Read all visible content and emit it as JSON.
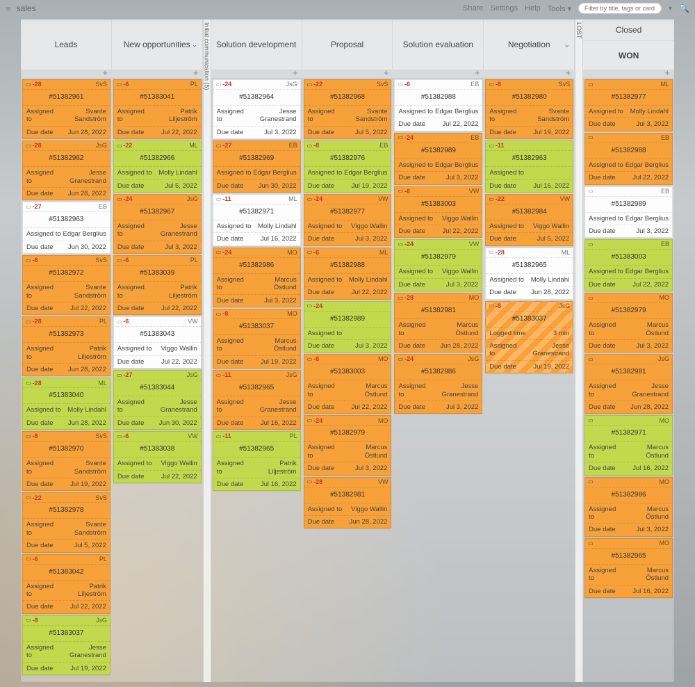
{
  "top": {
    "app": "sales",
    "links": {
      "share": "Share",
      "settings": "Settings",
      "help": "Help",
      "tools": "Tools ▾"
    },
    "filter_placeholder": "Filter by title, tags or card name"
  },
  "labels": {
    "assigned": "Assigned to",
    "due": "Due date",
    "logged": "Logged time"
  },
  "swimlanes": {
    "initial": "Initial communication (5)",
    "lost": "LOST"
  },
  "columns": [
    {
      "title": "Leads"
    },
    {
      "title": "New opportunities",
      "chevron": true
    },
    {
      "title": "Solution development"
    },
    {
      "title": "Proposal"
    },
    {
      "title": "Solution evaluation"
    },
    {
      "title": "Negotiation",
      "chevron": true
    },
    {
      "closed": "Closed",
      "won": "WON"
    }
  ],
  "board": [
    [
      {
        "c": "orange",
        "d": "-28",
        "in": "SvS",
        "id": "#51382961",
        "a": "Svante Sandström",
        "due": "Jun 28, 2022"
      },
      {
        "c": "orange",
        "d": "-28",
        "in": "JsG",
        "id": "#51382962",
        "a": "Jesse Granestrand",
        "due": "Jun 28, 2022"
      },
      {
        "c": "white",
        "d": "-27",
        "in": "EB",
        "id": "#51382963",
        "a": "Edgar Berglius",
        "due": "Jun 30, 2022"
      },
      {
        "c": "orange",
        "d": "-6",
        "in": "SvS",
        "id": "#51382972",
        "a": "Svante Sandström",
        "due": "Jul 22, 2022"
      },
      {
        "c": "orange",
        "d": "-28",
        "in": "PL",
        "id": "#51382973",
        "a": "Patrik Liljeström",
        "due": "Jun 28, 2022"
      },
      {
        "c": "yellow",
        "d": "-28",
        "in": "ML",
        "id": "#51383040",
        "a": "Molly Lindahl",
        "due": "Jun 28, 2022"
      },
      {
        "c": "orange",
        "d": "-8",
        "in": "SvS",
        "id": "#51382970",
        "a": "Svante Sandström",
        "due": "Jul 19, 2022"
      },
      {
        "c": "orange",
        "d": "-22",
        "in": "SvS",
        "id": "#51382978",
        "a": "Svante Sandström",
        "due": "Jul 5, 2022"
      },
      {
        "c": "orange",
        "d": "-6",
        "in": "PL",
        "id": "#51383042",
        "a": "Patrik Liljeström",
        "due": "Jul 22, 2022"
      },
      {
        "c": "yellow",
        "d": "-8",
        "in": "JsG",
        "id": "#51383037",
        "a": "Jesse Granestrand",
        "due": "Jul 19, 2022"
      }
    ],
    [
      {
        "c": "orange",
        "d": "-6",
        "in": "PL",
        "id": "#51383041",
        "a": "Patrik Liljeström",
        "due": "Jul 22, 2022"
      },
      {
        "c": "yellow",
        "d": "-22",
        "in": "ML",
        "id": "#51382966",
        "a": "Molly Lindahl",
        "due": "Jul 5, 2022"
      },
      {
        "c": "orange",
        "d": "-24",
        "in": "JsG",
        "id": "#51382967",
        "a": "Jesse Granestrand",
        "due": "Jul 3, 2022"
      },
      {
        "c": "orange",
        "d": "-6",
        "in": "PL",
        "id": "#51383039",
        "a": "Patrik Liljeström",
        "due": "Jul 22, 2022"
      },
      {
        "c": "white",
        "d": "-6",
        "in": "VW",
        "id": "#51383043",
        "a": "Viggo Wallin",
        "due": "Jul 22, 2022"
      },
      {
        "c": "yellow",
        "d": "-27",
        "in": "JsG",
        "id": "#51383044",
        "a": "Jesse Granestrand",
        "due": "Jun 30, 2022"
      },
      {
        "c": "yellow",
        "d": "-6",
        "in": "VW",
        "id": "#51383038",
        "a": "Viggo Wallin",
        "due": "Jul 22, 2022"
      }
    ],
    [
      {
        "c": "white",
        "d": "-24",
        "in": "JsG",
        "id": "#51382964",
        "a": "Jesse Granestrand",
        "due": "Jul 3, 2022"
      },
      {
        "c": "orange",
        "d": "-27",
        "in": "EB",
        "id": "#51382969",
        "a": "Edgar Berglius",
        "due": "Jun 30, 2022"
      },
      {
        "c": "white",
        "d": "-11",
        "in": "ML",
        "id": "#51382971",
        "a": "Molly Lindahl",
        "due": "Jul 16, 2022"
      },
      {
        "c": "orange",
        "d": "-24",
        "in": "MO",
        "id": "#51382986",
        "a": "Marcus Östlund",
        "due": "Jul 3, 2022"
      },
      {
        "c": "orange",
        "d": "-8",
        "in": "MO",
        "id": "#51383037",
        "a": "Marcus Östlund",
        "due": "Jul 19, 2022"
      },
      {
        "c": "orange",
        "d": "-11",
        "in": "JsG",
        "id": "#51382965",
        "a": "Jesse Granestrand",
        "due": "Jul 16, 2022"
      },
      {
        "c": "yellow",
        "d": "-11",
        "in": "PL",
        "id": "#51382965",
        "a": "Patrik Liljeström",
        "due": "Jul 16, 2022"
      }
    ],
    [
      {
        "c": "orange",
        "d": "-22",
        "in": "SvS",
        "id": "#51382968",
        "a": "Svante Sandström",
        "due": "Jul 5, 2022"
      },
      {
        "c": "yellow",
        "d": "-8",
        "in": "EB",
        "id": "#51382976",
        "a": "Edgar Berglius",
        "due": "Jul 19, 2022"
      },
      {
        "c": "orange",
        "d": "-24",
        "in": "VW",
        "id": "#51382977",
        "a": "Viggo Wallin",
        "due": "Jul 3, 2022"
      },
      {
        "c": "orange",
        "d": "-6",
        "in": "ML",
        "id": "#51382988",
        "a": "Molly Lindahl",
        "due": "Jul 22, 2022"
      },
      {
        "c": "yellow",
        "d": "-24",
        "in": "",
        "id": "#51382989",
        "a": "",
        "due": "Jul 3, 2022"
      },
      {
        "c": "orange",
        "d": "-6",
        "in": "MO",
        "id": "#51383003",
        "a": "Marcus Östlund",
        "due": "Jul 22, 2022"
      },
      {
        "c": "orange",
        "d": "-24",
        "in": "MO",
        "id": "#51382979",
        "a": "Marcus Östlund",
        "due": "Jul 3, 2022"
      },
      {
        "c": "orange",
        "d": "-28",
        "in": "VW",
        "id": "#51382981",
        "a": "Viggo Wallin",
        "due": "Jun 28, 2022"
      }
    ],
    [
      {
        "c": "white",
        "d": "-6",
        "in": "EB",
        "id": "#51382988",
        "a": "Edgar Berglius",
        "due": "Jul 22, 2022"
      },
      {
        "c": "orange",
        "d": "-24",
        "in": "EB",
        "id": "#51382989",
        "a": "Edgar Berglius",
        "due": "Jul 3, 2022"
      },
      {
        "c": "orange",
        "d": "-6",
        "in": "VW",
        "id": "#51383003",
        "a": "Viggo Wallin",
        "due": "Jul 22, 2022"
      },
      {
        "c": "yellow",
        "d": "-24",
        "in": "VW",
        "id": "#51382979",
        "a": "Viggo Wallin",
        "due": "Jul 3, 2022"
      },
      {
        "c": "orange",
        "d": "-28",
        "in": "MO",
        "id": "#51382981",
        "a": "Marcus Östlund",
        "due": "Jun 28, 2022"
      },
      {
        "c": "orange",
        "d": "-24",
        "in": "JsG",
        "id": "#51382986",
        "a": "Jesse Granestrand",
        "due": "Jul 3, 2022"
      }
    ],
    [
      {
        "c": "orange",
        "d": "-8",
        "in": "SvS",
        "id": "#51382980",
        "a": "Svante Sandström",
        "due": "Jul 19, 2022"
      },
      {
        "c": "yellow",
        "d": "-11",
        "in": "",
        "id": "#51382963",
        "a": "",
        "due": "Jul 16, 2022"
      },
      {
        "c": "orange",
        "d": "-22",
        "in": "VW",
        "id": "#51382984",
        "a": "Viggo Wallin",
        "due": "Jul 5, 2022"
      },
      {
        "c": "white",
        "d": "-28",
        "in": "ML",
        "id": "#51382965",
        "a": "Molly Lindahl",
        "due": "Jun 28, 2022"
      },
      {
        "c": "stripe",
        "d": "-8",
        "in": "JsG",
        "id": "#51383037",
        "a": "Jesse Granestrand",
        "due": "Jul 19, 2022",
        "logged": "3 min"
      }
    ],
    [
      {
        "c": "orange",
        "d": "",
        "in": "ML",
        "id": "#51382977",
        "a": "Molly Lindahl",
        "due": "Jul 3, 2022"
      },
      {
        "c": "orange",
        "d": "",
        "in": "EB",
        "id": "#51382988",
        "a": "Edgar Berglius",
        "due": "Jul 22, 2022"
      },
      {
        "c": "white",
        "d": "",
        "in": "EB",
        "id": "#51382989",
        "a": "Edgar Berglius",
        "due": "Jul 3, 2022"
      },
      {
        "c": "yellow",
        "d": "",
        "in": "EB",
        "id": "#51383003",
        "a": "Edgar Berglius",
        "due": "Jul 22, 2022"
      },
      {
        "c": "orange",
        "d": "",
        "in": "MO",
        "id": "#51382979",
        "a": "Marcus Östlund",
        "due": "Jul 3, 2022"
      },
      {
        "c": "orange",
        "d": "",
        "in": "JsG",
        "id": "#51382981",
        "a": "Jesse Granestrand",
        "due": "Jun 28, 2022"
      },
      {
        "c": "yellow",
        "d": "",
        "in": "MO",
        "id": "#51382971",
        "a": "Marcus Östlund",
        "due": "Jul 16, 2022"
      },
      {
        "c": "orange",
        "d": "",
        "in": "MO",
        "id": "#51382986",
        "a": "Marcus Östlund",
        "due": "Jul 3, 2022"
      },
      {
        "c": "orange",
        "d": "",
        "in": "MO",
        "id": "#51382965",
        "a": "Marcus Östlund",
        "due": "Jul 16, 2022"
      }
    ]
  ]
}
